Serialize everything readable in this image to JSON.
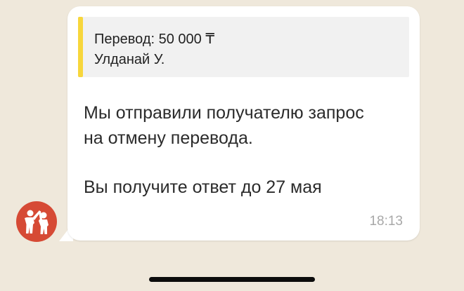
{
  "chat": {
    "message": {
      "quote": {
        "title": "Перевод: 50 000 ₸",
        "recipient": "Улданай У."
      },
      "text_line_1": "Мы отправили получателю запрос",
      "text_line_2": "на отмену перевода.",
      "text_line_3": "Вы получите ответ до 27 мая",
      "time": "18:13"
    },
    "sender": {
      "avatar_icon": "two-people-high-five-icon"
    }
  },
  "colors": {
    "background": "#efe8db",
    "bubble": "#ffffff",
    "quote_bar": "#f7d63c",
    "avatar": "#d64a35"
  }
}
